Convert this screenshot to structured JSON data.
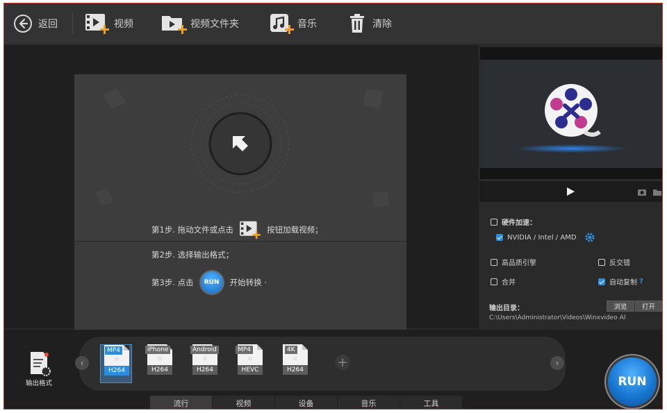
{
  "toolbar": {
    "back": "返回",
    "video": "视频",
    "folder": "视频文件夹",
    "music": "音乐",
    "clear": "清除"
  },
  "steps": {
    "step1_before": "第1步. 拖动文件或点击",
    "step1_after": "按钮加载视频；",
    "step2": "第2步. 选择输出格式；",
    "step3_before": "第3步. 点击",
    "step3_run": "RUN",
    "step3_after": "开始转换 ·"
  },
  "options": {
    "hw_accel_label": "硬件加速：",
    "gpu_label": "NVIDIA / Intel / AMD",
    "high_quality": "高品质引擎",
    "deinterlace": "反交错",
    "merge": "合并",
    "auto_copy": "自动复制",
    "help": "?"
  },
  "output": {
    "label": "输出目录：",
    "browse": "浏览",
    "open": "打开",
    "path": "C:\\Users\\Administrator\\Videos\\Winxvideo AI"
  },
  "output_format": {
    "label": "输出格式"
  },
  "formats": [
    {
      "top": "MP4",
      "codec": "H264",
      "selected": true
    },
    {
      "top": "iPhone",
      "codec": "H264",
      "selected": false
    },
    {
      "top": "Android",
      "codec": "H264",
      "selected": false
    },
    {
      "top": "MP4",
      "codec": "HEVC",
      "selected": false
    },
    {
      "top": "4K",
      "codec": "H264",
      "selected": false
    }
  ],
  "tabs": [
    "流行",
    "视频",
    "设备",
    "音乐",
    "工具"
  ],
  "run_label": "RUN",
  "colors": {
    "accent": "#2b8de0",
    "background": "#2a2a2a",
    "toolbar": "#333334"
  }
}
